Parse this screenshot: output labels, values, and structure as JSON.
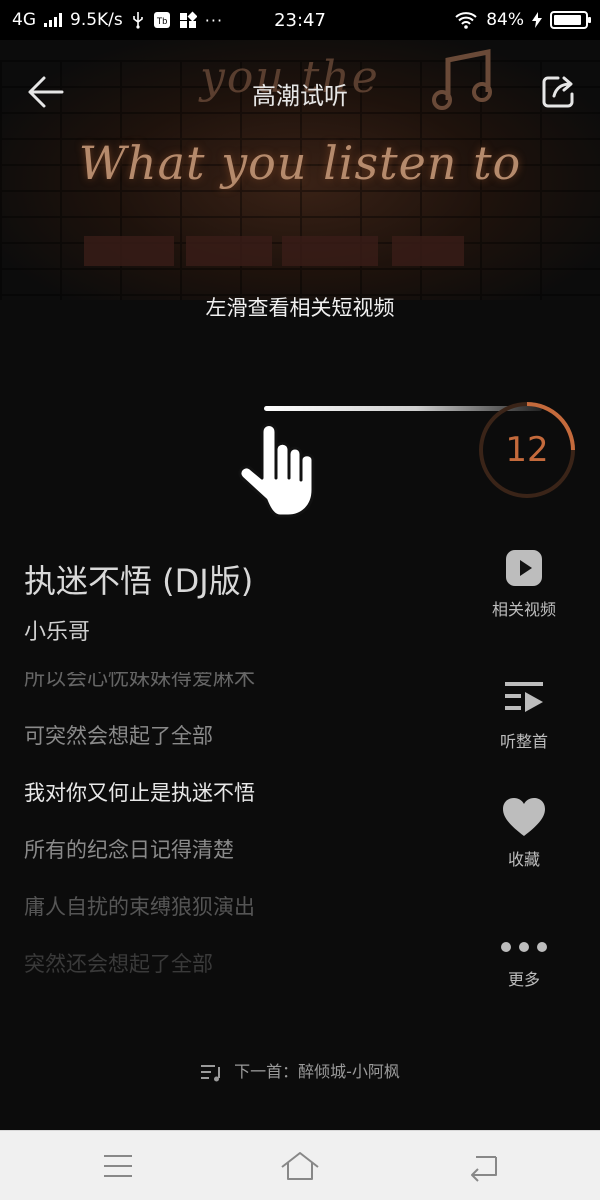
{
  "status_bar": {
    "network": "4G",
    "speed": "9.5K/s",
    "time": "23:47",
    "battery": "84%"
  },
  "header": {
    "title": "高潮试听",
    "hero_text_top": "you the",
    "hero_text_main": "What you listen to"
  },
  "hint": "左滑查看相关短视频",
  "countdown": "12",
  "song": {
    "title": "执迷不悟 (DJ版)",
    "artist": "小乐哥"
  },
  "lyrics": [
    {
      "text": "所以会心忧妹妹得爱麻木",
      "state": "fading-top"
    },
    {
      "text": "可突然会想起了全部",
      "state": "past"
    },
    {
      "text": "我对你又何止是执迷不悟",
      "state": "current"
    },
    {
      "text": "所有的纪念日记得清楚",
      "state": "next"
    },
    {
      "text": "庸人自扰的束缚狼狈演出",
      "state": "upcoming"
    },
    {
      "text": "突然还会想起了全部",
      "state": "upcoming-far"
    }
  ],
  "actions": [
    {
      "name": "related-video",
      "label": "相关视频",
      "icon": "play-icon"
    },
    {
      "name": "full-song",
      "label": "听整首",
      "icon": "playlist-icon"
    },
    {
      "name": "favorite",
      "label": "收藏",
      "icon": "heart-icon"
    },
    {
      "name": "more",
      "label": "更多",
      "icon": "more-dots-icon"
    }
  ],
  "next_song": "下一首：醉倾城-小阿枫",
  "colors": {
    "accent": "#c46a3c",
    "background": "#0c0c0c",
    "nav_bar": "#f0f0f0"
  }
}
